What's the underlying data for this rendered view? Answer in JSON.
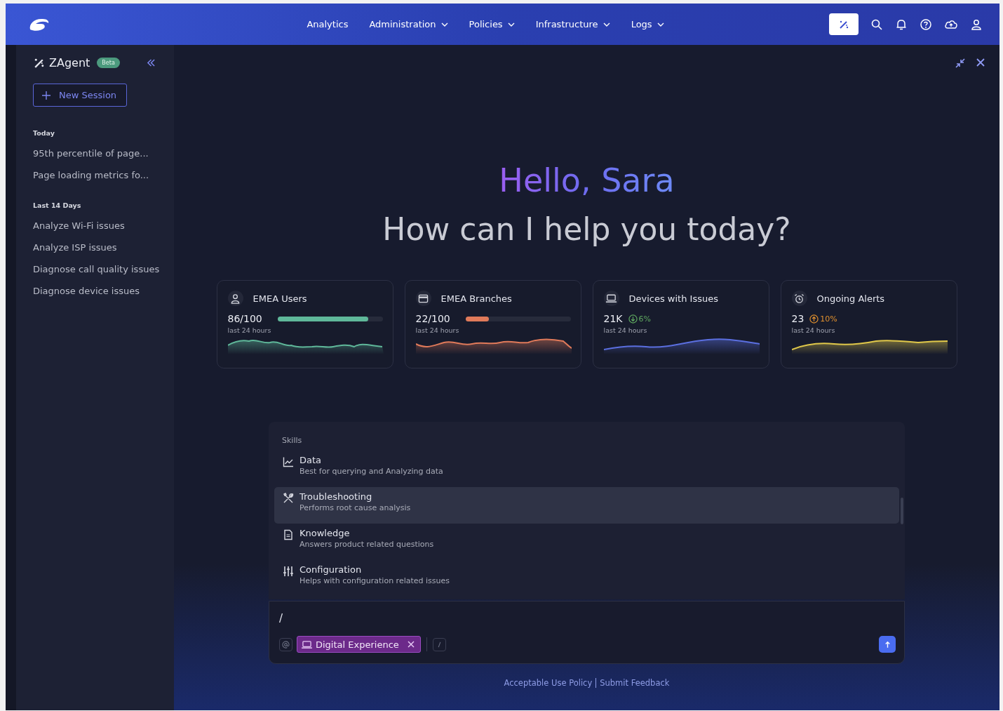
{
  "nav": {
    "items": [
      {
        "label": "Analytics",
        "dropdown": false
      },
      {
        "label": "Administration",
        "dropdown": true
      },
      {
        "label": "Policies",
        "dropdown": true
      },
      {
        "label": "Infrastructure",
        "dropdown": true
      },
      {
        "label": "Logs",
        "dropdown": true
      }
    ]
  },
  "sidebar": {
    "title": "ZAgent",
    "badge": "Beta",
    "new_session": "New Session",
    "groups": [
      {
        "heading": "Today",
        "items": [
          "95th percentile of page...",
          "Page loading metrics fo..."
        ]
      },
      {
        "heading": "Last 14 Days",
        "items": [
          "Analyze Wi-Fi issues",
          "Analyze ISP issues",
          "Diagnose call quality issues",
          "Diagnose device issues"
        ]
      }
    ]
  },
  "greeting": {
    "hello": "Hello, Sara",
    "question": "How can I help you today?"
  },
  "cards": [
    {
      "kind": "user",
      "title": "EMEA Users",
      "value": "86/100",
      "level": 0.86,
      "color": "#5fb89a",
      "subtitle": "last 24 hours"
    },
    {
      "kind": "branch",
      "title": "EMEA Branches",
      "value": "22/100",
      "level": 0.22,
      "color": "#e07a5a",
      "subtitle": "last 24 hours"
    },
    {
      "kind": "device",
      "title": "Devices with Issues",
      "value": "21K",
      "delta": {
        "rising": false,
        "text": "6%"
      },
      "color": "#5b6fe0",
      "subtitle": "last 24 hours"
    },
    {
      "kind": "alarm",
      "title": "Ongoing Alerts",
      "value": "23",
      "delta": {
        "rising": true,
        "text": "10%"
      },
      "color": "#e0c84a",
      "subtitle": "last 24 hours"
    }
  ],
  "skills": {
    "heading": "Skills",
    "items": [
      {
        "kind": "chart",
        "title": "Data",
        "description": "Best for querying and Analyzing data",
        "selected": false
      },
      {
        "kind": "tools",
        "title": "Troubleshooting",
        "description": "Performs root cause analysis",
        "selected": true
      },
      {
        "kind": "document",
        "title": "Knowledge",
        "description": "Answers product related questions",
        "selected": false
      },
      {
        "kind": "sliders",
        "title": "Configuration",
        "description": "Helps with configuration related issues",
        "selected": false
      }
    ]
  },
  "composer": {
    "value": "/",
    "chip": "Digital Experience"
  },
  "footer": {
    "links": [
      "Acceptable Use Policy",
      "Submit Feedback"
    ]
  }
}
